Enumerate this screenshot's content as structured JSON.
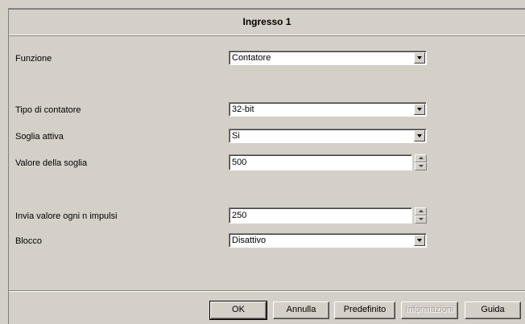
{
  "dialog": {
    "title": "Ingresso 1"
  },
  "fields": {
    "funzione": {
      "label": "Funzione",
      "value": "Contatore"
    },
    "tipo_contatore": {
      "label": "Tipo di contatore",
      "value": "32-bit"
    },
    "soglia_attiva": {
      "label": "Soglia attiva",
      "value": "Si"
    },
    "valore_soglia": {
      "label": "Valore della soglia",
      "value": "500"
    },
    "invia_valore": {
      "label": "Invia valore ogni n impulsi",
      "value": "250"
    },
    "blocco": {
      "label": "Blocco",
      "value": "Disattivo"
    }
  },
  "buttons": {
    "ok": "OK",
    "annulla": "Annulla",
    "predefinito": "Predefinito",
    "informazioni": "Informazioni",
    "guida": "Guida"
  },
  "icons": {
    "dropdown": "chevron-down-icon",
    "spin_up": "spin-up-icon",
    "spin_down": "spin-down-icon"
  }
}
